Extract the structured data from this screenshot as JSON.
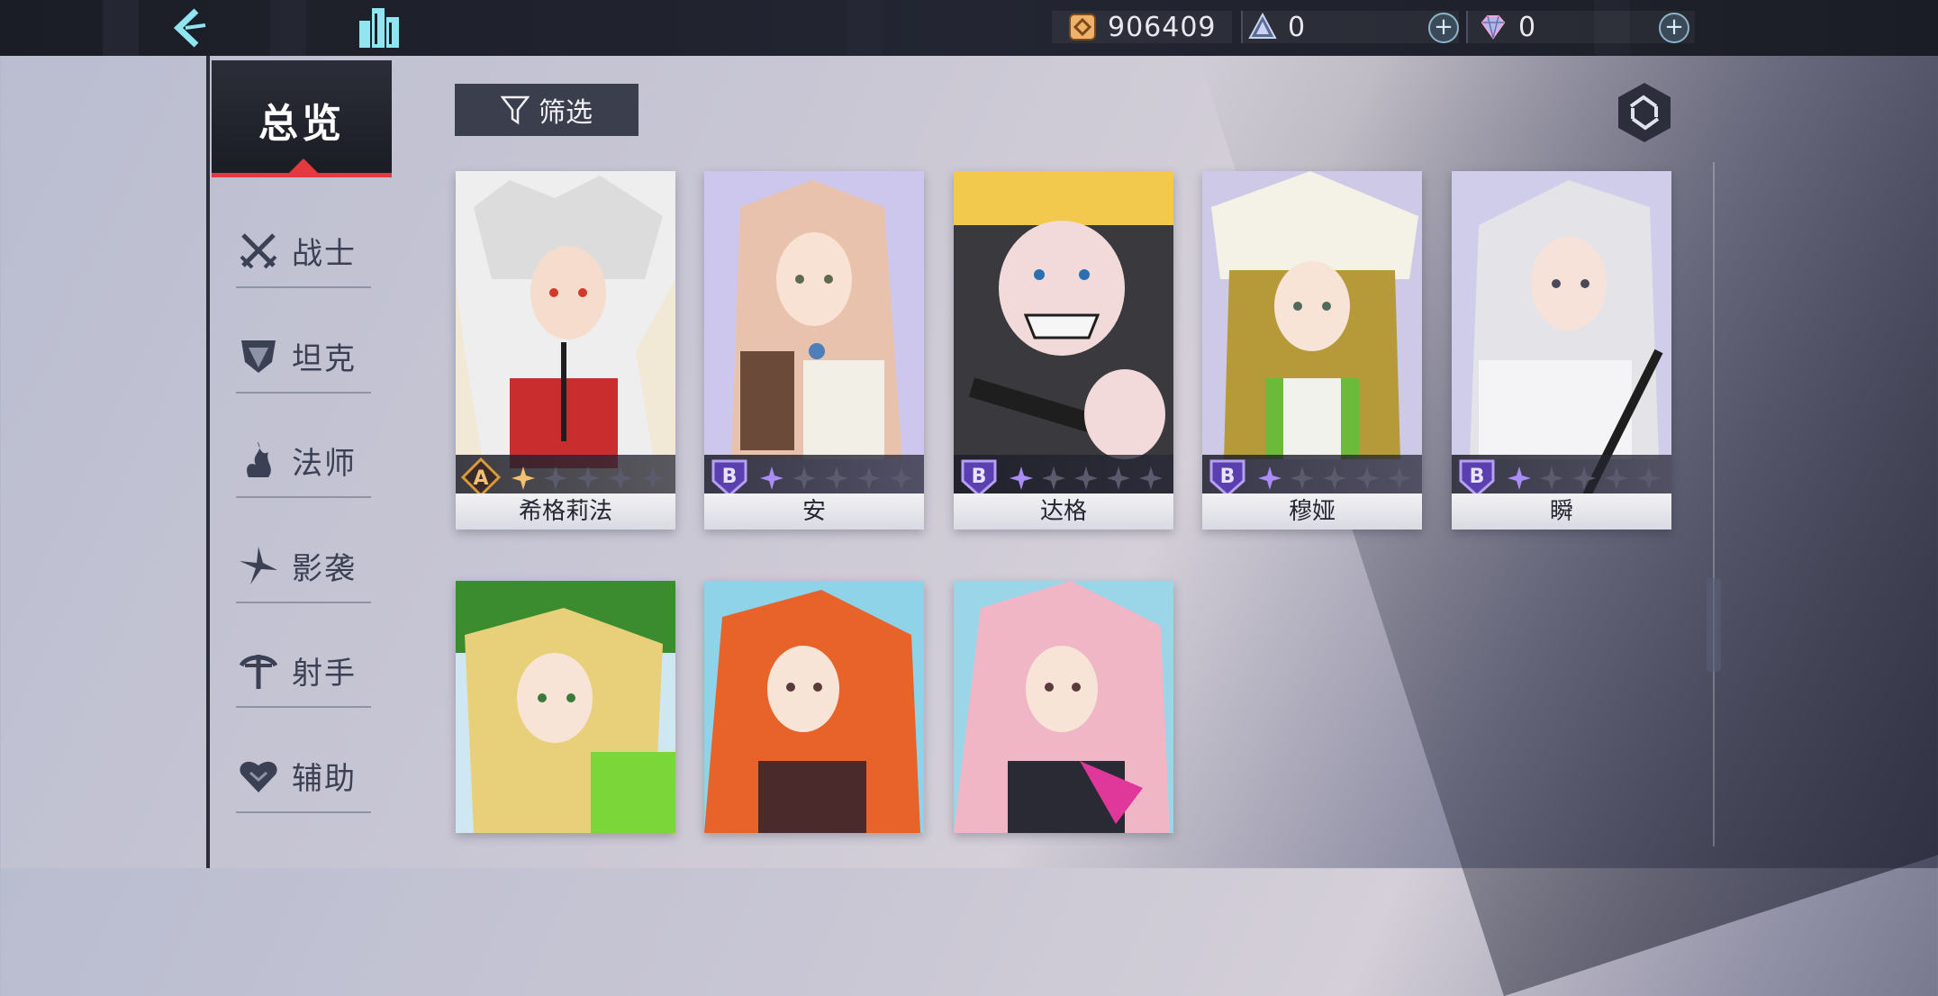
{
  "topbar": {
    "gold": {
      "icon": "gold-coin-icon",
      "value": "906409"
    },
    "crystal": {
      "icon": "crystal-icon",
      "value": "0"
    },
    "diamond": {
      "icon": "diamond-icon",
      "value": "0"
    },
    "plus_label": "+"
  },
  "nav": {
    "overview": "总览",
    "items": [
      {
        "label": "战士",
        "icon": "warrior-swords-icon"
      },
      {
        "label": "坦克",
        "icon": "tank-shield-icon"
      },
      {
        "label": "法师",
        "icon": "mage-flame-icon"
      },
      {
        "label": "影袭",
        "icon": "assassin-shuriken-icon"
      },
      {
        "label": "射手",
        "icon": "marksman-bow-icon"
      },
      {
        "label": "辅助",
        "icon": "support-heart-icon"
      }
    ]
  },
  "filter_label": "筛选",
  "accent": {
    "red": "#e23a3e",
    "tierA": "#d99a3a",
    "tierB": "#7d5ad6"
  },
  "heroes": [
    {
      "name": "希格莉法",
      "tier": "A",
      "stars_lit": 1,
      "stars_total": 5
    },
    {
      "name": "安",
      "tier": "B",
      "stars_lit": 1,
      "stars_total": 5
    },
    {
      "name": "达格",
      "tier": "B",
      "stars_lit": 1,
      "stars_total": 5
    },
    {
      "name": "穆娅",
      "tier": "B",
      "stars_lit": 1,
      "stars_total": 5
    },
    {
      "name": "瞬",
      "tier": "B",
      "stars_lit": 1,
      "stars_total": 5
    },
    {
      "name": "",
      "tier": "",
      "stars_lit": 0,
      "stars_total": 0
    },
    {
      "name": "",
      "tier": "",
      "stars_lit": 0,
      "stars_total": 0
    },
    {
      "name": "",
      "tier": "",
      "stars_lit": 0,
      "stars_total": 0
    }
  ]
}
